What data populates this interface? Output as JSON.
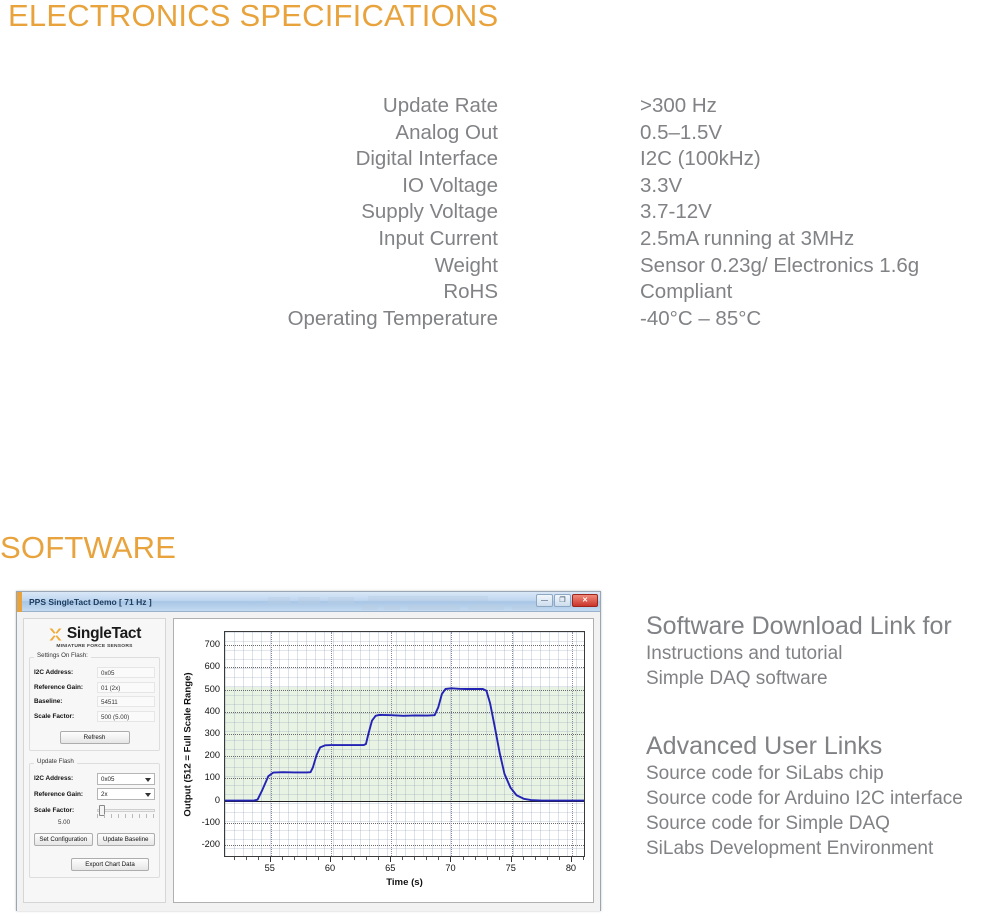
{
  "headings": {
    "electronics": "ELECTRONICS SPECIFICATIONS",
    "software": "SOFTWARE",
    "accent_color": "#e8a33d",
    "body_color": "#808285"
  },
  "specs": {
    "rows": [
      {
        "label": "Update Rate",
        "value": ">300 Hz"
      },
      {
        "label": "Analog Out",
        "value": "0.5–1.5V"
      },
      {
        "label": "Digital Interface",
        "value": "I2C (100kHz)"
      },
      {
        "label": "IO Voltage",
        "value": "3.3V"
      },
      {
        "label": "Supply Voltage",
        "value": "3.7-12V"
      },
      {
        "label": "Input Current",
        "value": "2.5mA  running at 3MHz"
      },
      {
        "label": "Weight",
        "value": "Sensor 0.23g/ Electronics 1.6g"
      },
      {
        "label": "RoHS",
        "value": "Compliant"
      },
      {
        "label": "Operating Temperature",
        "value": "-40°C – 85°C"
      }
    ]
  },
  "app": {
    "title": "PPS SingleTact Demo [ 71 Hz ]",
    "window_buttons": {
      "minimize": "—",
      "maximize": "❐",
      "close": "✕"
    },
    "logo": {
      "name": "SingleTact",
      "tagline": "MINIATURE FORCE SENSORS",
      "mark_color": "#f0a830"
    },
    "settings_on_flash": {
      "title": "Settings On Flash:",
      "fields": [
        {
          "label": "I2C Address:",
          "value": "0x05"
        },
        {
          "label": "Reference Gain:",
          "value": "01 (2x)"
        },
        {
          "label": "Baseline:",
          "value": "54511"
        },
        {
          "label": "Scale Factor:",
          "value": "500 (5.00)"
        }
      ],
      "refresh_button": "Refresh"
    },
    "update_flash": {
      "title": "Update Flash",
      "i2c_address_label": "I2C Address:",
      "i2c_address_value": "0x05",
      "reference_gain_label": "Reference Gain:",
      "reference_gain_value": "2x",
      "scale_factor_label": "Scale Factor:",
      "scale_factor_value": "5.00",
      "set_configuration_button": "Set Configuration",
      "update_baseline_button": "Update Baseline",
      "export_chart_data_button": "Export Chart Data"
    }
  },
  "chart_data": {
    "type": "line",
    "title": "",
    "xlabel": "Time (s)",
    "ylabel": "Output (512 = Full Scale Range)",
    "xlim": [
      51.2,
      81.0
    ],
    "ylim": [
      -250,
      760
    ],
    "xticks": [
      55,
      60,
      65,
      70,
      75,
      80
    ],
    "yticks": [
      -200,
      -100,
      0,
      100,
      200,
      300,
      400,
      500,
      600,
      700
    ],
    "grid": true,
    "legend": null,
    "line_color": "#2323b4",
    "shaded_band": {
      "from": 0,
      "to": 512,
      "color": "#e9f3e4",
      "label": "full scale range"
    },
    "series": [
      {
        "name": "Output",
        "x": [
          51.2,
          52.0,
          53.0,
          53.6,
          53.9,
          54.3,
          54.8,
          55.2,
          56.0,
          57.0,
          58.0,
          58.3,
          58.5,
          58.8,
          59.1,
          59.5,
          60.0,
          61.0,
          62.0,
          62.7,
          62.9,
          63.1,
          63.4,
          63.7,
          64.0,
          65.0,
          66.0,
          67.0,
          68.0,
          68.6,
          68.9,
          69.2,
          69.5,
          70.0,
          70.6,
          71.2,
          72.0,
          72.6,
          72.9,
          73.2,
          73.6,
          74.0,
          74.4,
          74.9,
          75.4,
          76.0,
          76.6,
          77.5,
          79.0,
          81.0
        ],
        "y": [
          0,
          0,
          0,
          0,
          4,
          48,
          110,
          126,
          128,
          127,
          127,
          128,
          150,
          205,
          240,
          249,
          250,
          250,
          250,
          250,
          255,
          300,
          360,
          382,
          386,
          385,
          382,
          384,
          383,
          385,
          420,
          480,
          503,
          506,
          504,
          503,
          503,
          503,
          495,
          440,
          330,
          215,
          120,
          58,
          24,
          8,
          2,
          0,
          0,
          0
        ]
      }
    ]
  },
  "links": {
    "download": {
      "title": "Software Download Link for",
      "items": [
        "Instructions and tutorial",
        "Simple DAQ software"
      ]
    },
    "advanced": {
      "title": "Advanced User Links",
      "items": [
        "Source code for SiLabs chip",
        "Source code for Arduino I2C interface",
        "Source code for Simple DAQ",
        "SiLabs Development Environment"
      ]
    }
  }
}
